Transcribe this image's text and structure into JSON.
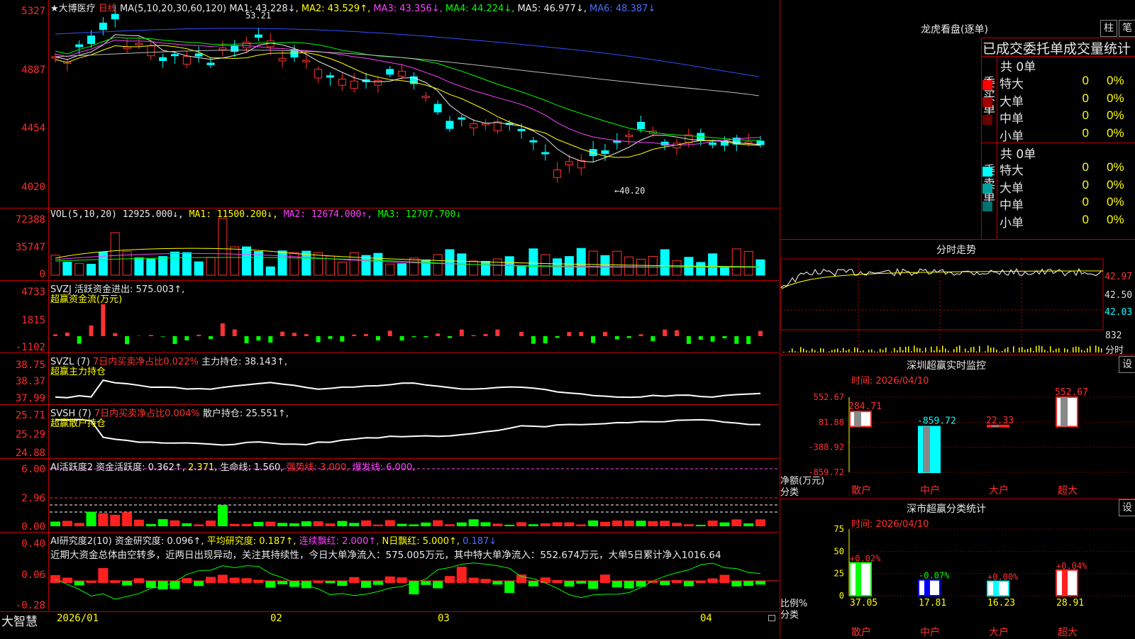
{
  "stock": {
    "title": "★大博医疗",
    "period": "日线"
  },
  "price": {
    "ma_label": "MA(5,10,20,30,60,120)",
    "ma1": "MA1: 43.228↓,",
    "ma2": "MA2: 43.529↑,",
    "ma3": "MA3: 43.356↓,",
    "ma4": "MA4: 44.224↓,",
    "ma5": "MA5: 46.977↓,",
    "ma6": "MA6: 48.387↓",
    "ticks": [
      "5327",
      "4887",
      "4454",
      "4020"
    ],
    "high_label": "53.21",
    "low_label": "←40.20"
  },
  "vol": {
    "label": "VOL(5,10,20)",
    "value": "12925.000↓,",
    "ma1": "MA1: 11500.200↓,",
    "ma2": "MA2: 12674.000↑,",
    "ma3": "MA3: 12707.700↓",
    "ticks": [
      "72388",
      "35747",
      "0"
    ]
  },
  "svzj": {
    "label": "SVZJ  活跃资金进出: 575.003↑,",
    "sub": "超赢资金流(万元)",
    "ticks": [
      "4733",
      "1815",
      "-1102"
    ]
  },
  "svzl": {
    "name": "SVZL (7)",
    "red": "7日内买卖净占比0.022%",
    "white": "主力持仓: 38.143↑,",
    "sub": "超赢主力持仓",
    "ticks": [
      "38.75",
      "38.37",
      "37.99"
    ]
  },
  "svsh": {
    "name": "SVSH (7)",
    "red": "7日内买卖净占比0.004%",
    "white": "散户持仓: 25.551↑,",
    "sub": "超赢散户持仓",
    "ticks": [
      "25.71",
      "25.29",
      "24.88"
    ]
  },
  "ai_act": {
    "l1": "AI活跃度2 资金活跃度: 0.362↑,",
    "l2": "2.371,",
    "l3": "生命线: 1.560,",
    "l4": "强势线: 3.000,",
    "l5": "爆发线: 6.000,",
    "ticks": [
      "6.00",
      "2.96",
      "0.00"
    ]
  },
  "ai_res": {
    "l1": "AI研究度2(10) 资金研究度: 0.096↑,",
    "l2": "平均研究度: 0.187↑,",
    "l3": "连续飘红: 2.000↑,",
    "l4": "N日飘红: 5.000↑,",
    "l5": "0.187↓",
    "comment": "近期大资金总体由空转多，近两日出现异动，关注其持续性，今日大单净流入：575.005万元，其中特大单净流入：552.674万元，大单5日累计净入1016.64",
    "ticks": [
      "0.40",
      "0.06",
      "-0.28"
    ]
  },
  "xaxis": {
    "brand": "大智慧",
    "labels": [
      "2026/01",
      "02",
      "03",
      "04"
    ]
  },
  "dragon": {
    "title": "龙虎看盘(逐单)",
    "btn1": "柱",
    "btn2": "笔",
    "subtitle": "已成交委托单成交量统计",
    "buy_side": "委买单",
    "sell_side": "委卖单",
    "buy_total": "共 0单",
    "sell_total": "共 0单",
    "buy_rows": [
      {
        "label": "特大",
        "num": "0",
        "pct": "0%",
        "color": "#ff0000"
      },
      {
        "label": "大单",
        "num": "0",
        "pct": "0%",
        "color": "#a00000"
      },
      {
        "label": "中单",
        "num": "0",
        "pct": "0%",
        "color": "#6a0000"
      },
      {
        "label": "小单",
        "num": "0",
        "pct": "0%",
        "color": "#000000"
      }
    ],
    "sell_rows": [
      {
        "label": "特大",
        "num": "0",
        "pct": "0%",
        "color": "#00ffff"
      },
      {
        "label": "大单",
        "num": "0",
        "pct": "0%",
        "color": "#00a0a0"
      },
      {
        "label": "中单",
        "num": "0",
        "pct": "0%",
        "color": "#007070"
      },
      {
        "label": "小单",
        "num": "0",
        "pct": "0%",
        "color": "#000000"
      }
    ]
  },
  "intraday": {
    "title": "分时走势",
    "ticks": [
      "42.97",
      "42.50",
      "42.03"
    ],
    "vol_tick": "832",
    "unit": "分时"
  },
  "monitor": {
    "title": "深圳超赢实时监控",
    "btn": "设",
    "time": "时间: 2026/04/10",
    "ylabel": "净额(万元)",
    "xlabel": "分类",
    "ticks": [
      "552.67",
      "81.88",
      "-388.92",
      "-859.72"
    ]
  },
  "classify": {
    "title": "深市超赢分类统计",
    "btn": "设",
    "time": "时间: 2026/04/10",
    "ylabel": "比例%",
    "xlabel": "分类",
    "ticks": [
      "75",
      "50",
      "25",
      "0"
    ]
  },
  "colors": {
    "up": "#ff3232",
    "down": "#00ffff",
    "grid": "#c00000"
  },
  "chart_data": [
    {
      "type": "bar",
      "title": "深圳超赢实时监控",
      "categories": [
        "散户",
        "中户",
        "大户",
        "超大"
      ],
      "values": [
        284.71,
        -859.72,
        22.33,
        552.67
      ],
      "labels": [
        "284.71",
        "-859.72",
        "22.33",
        "552.67"
      ],
      "ylim": [
        -859.72,
        552.67
      ]
    },
    {
      "type": "bar",
      "title": "深市超赢分类统计",
      "categories": [
        "散户",
        "中户",
        "大户",
        "超大"
      ],
      "values": [
        37.05,
        17.81,
        16.23,
        28.91
      ],
      "value_labels": [
        "37.05",
        "17.81",
        "16.23",
        "28.91"
      ],
      "change_labels": [
        "+0.02%",
        "-0.07%",
        "+0.00%",
        "+0.04%"
      ],
      "ylim": [
        0,
        75
      ]
    }
  ]
}
